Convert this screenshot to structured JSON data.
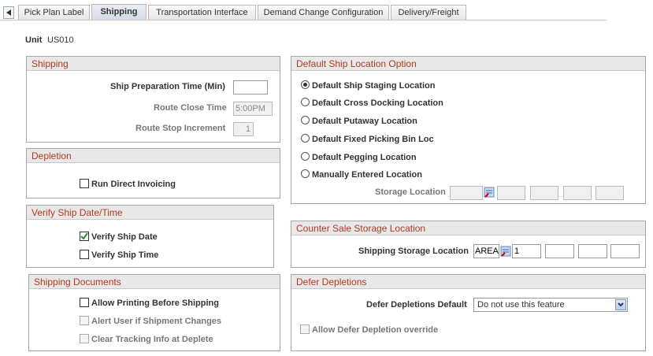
{
  "tabs": [
    {
      "label": "Pick Plan Label"
    },
    {
      "label": "Shipping"
    },
    {
      "label": "Transportation Interface"
    },
    {
      "label": "Demand Change Configuration"
    },
    {
      "label": "Delivery/Freight"
    }
  ],
  "unit": {
    "label": "Unit",
    "value": "US010"
  },
  "shipping": {
    "title": "Shipping",
    "prep_time_label": "Ship Preparation Time (Min)",
    "prep_time_value": "",
    "route_close_label": "Route Close Time",
    "route_close_value": "5:00PM",
    "route_stop_label": "Route Stop Increment",
    "route_stop_value": "1"
  },
  "depletion": {
    "title": "Depletion",
    "run_direct_invoicing": "Run Direct Invoicing"
  },
  "verify": {
    "title": "Verify Ship Date/Time",
    "ship_date": "Verify Ship Date",
    "ship_time": "Verify Ship Time",
    "ship_date_checked": true,
    "ship_time_checked": false
  },
  "docs": {
    "title": "Shipping Documents",
    "allow_printing": "Allow Printing Before Shipping",
    "alert_user": "Alert User if Shipment Changes",
    "clear_tracking": "Clear Tracking Info at Deplete"
  },
  "default_ship": {
    "title": "Default Ship Location Option",
    "options": [
      "Default Ship Staging Location",
      "Default Cross Docking Location",
      "Default Putaway Location",
      "Default Fixed Picking Bin Loc",
      "Default Pegging Location",
      "Manually Entered Location"
    ],
    "selected_index": 0,
    "storage_label": "Storage Location"
  },
  "counter_sale": {
    "title": "Counter Sale Storage Location",
    "label": "Shipping Storage Location",
    "area": "AREA",
    "level1": "1"
  },
  "defer": {
    "title": "Defer Depletions",
    "default_label": "Defer Depletions Default",
    "default_value": "Do not use this feature",
    "override_label": "Allow Defer Depletion override"
  }
}
